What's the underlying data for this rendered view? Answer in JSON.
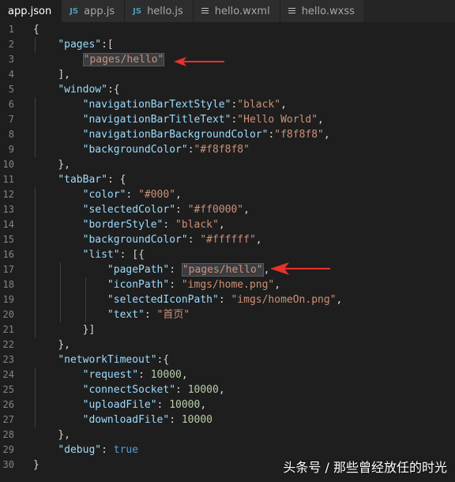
{
  "tabs": [
    {
      "label": "app.json",
      "icon": "none",
      "active": true
    },
    {
      "label": "app.js",
      "icon": "js-icon",
      "active": false
    },
    {
      "label": "hello.js",
      "icon": "js-icon",
      "active": false
    },
    {
      "label": "hello.wxml",
      "icon": "lines-icon",
      "active": false
    },
    {
      "label": "hello.wxss",
      "icon": "lines-icon",
      "active": false
    }
  ],
  "js_badge": "JS",
  "code_lines": [
    {
      "n": "1",
      "tokens": [
        {
          "t": "{",
          "c": "p"
        }
      ]
    },
    {
      "n": "2",
      "tokens": [
        {
          "t": "    "
        },
        {
          "t": "\"pages\"",
          "c": "key"
        },
        {
          "t": ":[",
          "c": "p"
        }
      ]
    },
    {
      "n": "3",
      "tokens": [
        {
          "t": "        "
        },
        {
          "t": "\"pages/hello\"",
          "c": "str",
          "hl": true
        }
      ]
    },
    {
      "n": "4",
      "tokens": [
        {
          "t": "    "
        },
        {
          "t": "],",
          "c": "p"
        }
      ]
    },
    {
      "n": "5",
      "tokens": [
        {
          "t": "    "
        },
        {
          "t": "\"window\"",
          "c": "key"
        },
        {
          "t": ":{",
          "c": "p"
        }
      ]
    },
    {
      "n": "6",
      "tokens": [
        {
          "t": "        "
        },
        {
          "t": "\"navigationBarTextStyle\"",
          "c": "key"
        },
        {
          "t": ":",
          "c": "p"
        },
        {
          "t": "\"black\"",
          "c": "str"
        },
        {
          "t": ",",
          "c": "p"
        }
      ]
    },
    {
      "n": "7",
      "tokens": [
        {
          "t": "        "
        },
        {
          "t": "\"navigationBarTitleText\"",
          "c": "key"
        },
        {
          "t": ":",
          "c": "p"
        },
        {
          "t": "\"Hello World\"",
          "c": "str"
        },
        {
          "t": ",",
          "c": "p"
        }
      ]
    },
    {
      "n": "8",
      "tokens": [
        {
          "t": "        "
        },
        {
          "t": "\"navigationBarBackgroundColor\"",
          "c": "key"
        },
        {
          "t": ":",
          "c": "p"
        },
        {
          "t": "\"f8f8f8\"",
          "c": "str"
        },
        {
          "t": ",",
          "c": "p"
        }
      ]
    },
    {
      "n": "9",
      "tokens": [
        {
          "t": "        "
        },
        {
          "t": "\"backgroundColor\"",
          "c": "key"
        },
        {
          "t": ":",
          "c": "p"
        },
        {
          "t": "\"#f8f8f8\"",
          "c": "str"
        }
      ]
    },
    {
      "n": "10",
      "tokens": [
        {
          "t": "    "
        },
        {
          "t": "},",
          "c": "p"
        }
      ]
    },
    {
      "n": "11",
      "tokens": [
        {
          "t": "    "
        },
        {
          "t": "\"tabBar\"",
          "c": "key"
        },
        {
          "t": ": {",
          "c": "p"
        }
      ]
    },
    {
      "n": "12",
      "tokens": [
        {
          "t": "        "
        },
        {
          "t": "\"color\"",
          "c": "key"
        },
        {
          "t": ": ",
          "c": "p"
        },
        {
          "t": "\"#000\"",
          "c": "str"
        },
        {
          "t": ",",
          "c": "p"
        }
      ]
    },
    {
      "n": "13",
      "tokens": [
        {
          "t": "        "
        },
        {
          "t": "\"selectedColor\"",
          "c": "key"
        },
        {
          "t": ": ",
          "c": "p"
        },
        {
          "t": "\"#ff0000\"",
          "c": "str"
        },
        {
          "t": ",",
          "c": "p"
        }
      ]
    },
    {
      "n": "14",
      "tokens": [
        {
          "t": "        "
        },
        {
          "t": "\"borderStyle\"",
          "c": "key"
        },
        {
          "t": ": ",
          "c": "p"
        },
        {
          "t": "\"black\"",
          "c": "str"
        },
        {
          "t": ",",
          "c": "p"
        }
      ]
    },
    {
      "n": "15",
      "tokens": [
        {
          "t": "        "
        },
        {
          "t": "\"backgroundColor\"",
          "c": "key"
        },
        {
          "t": ": ",
          "c": "p"
        },
        {
          "t": "\"#ffffff\"",
          "c": "str"
        },
        {
          "t": ",",
          "c": "p"
        }
      ]
    },
    {
      "n": "16",
      "tokens": [
        {
          "t": "        "
        },
        {
          "t": "\"list\"",
          "c": "key"
        },
        {
          "t": ": [{",
          "c": "p"
        }
      ]
    },
    {
      "n": "17",
      "tokens": [
        {
          "t": "            "
        },
        {
          "t": "\"pagePath\"",
          "c": "key"
        },
        {
          "t": ": ",
          "c": "p"
        },
        {
          "t": "\"pages/hello\"",
          "c": "str",
          "hl": true
        },
        {
          "t": ",",
          "c": "p"
        }
      ]
    },
    {
      "n": "18",
      "tokens": [
        {
          "t": "            "
        },
        {
          "t": "\"iconPath\"",
          "c": "key"
        },
        {
          "t": ": ",
          "c": "p"
        },
        {
          "t": "\"imgs/home.png\"",
          "c": "str"
        },
        {
          "t": ",",
          "c": "p"
        }
      ]
    },
    {
      "n": "19",
      "tokens": [
        {
          "t": "            "
        },
        {
          "t": "\"selectedIconPath\"",
          "c": "key"
        },
        {
          "t": ": ",
          "c": "p"
        },
        {
          "t": "\"imgs/homeOn.png\"",
          "c": "str"
        },
        {
          "t": ",",
          "c": "p"
        }
      ]
    },
    {
      "n": "20",
      "tokens": [
        {
          "t": "            "
        },
        {
          "t": "\"text\"",
          "c": "key"
        },
        {
          "t": ": ",
          "c": "p"
        },
        {
          "t": "\"首页\"",
          "c": "str"
        }
      ]
    },
    {
      "n": "21",
      "tokens": [
        {
          "t": "        "
        },
        {
          "t": "}]",
          "c": "p"
        }
      ]
    },
    {
      "n": "22",
      "tokens": [
        {
          "t": "    "
        },
        {
          "t": "},",
          "c": "p"
        }
      ]
    },
    {
      "n": "23",
      "tokens": [
        {
          "t": "    "
        },
        {
          "t": "\"networkTimeout\"",
          "c": "key"
        },
        {
          "t": ":{",
          "c": "p"
        }
      ]
    },
    {
      "n": "24",
      "tokens": [
        {
          "t": "        "
        },
        {
          "t": "\"request\"",
          "c": "key"
        },
        {
          "t": ": ",
          "c": "p"
        },
        {
          "t": "10000",
          "c": "num"
        },
        {
          "t": ",",
          "c": "p"
        }
      ]
    },
    {
      "n": "25",
      "tokens": [
        {
          "t": "        "
        },
        {
          "t": "\"connectSocket\"",
          "c": "key"
        },
        {
          "t": ": ",
          "c": "p"
        },
        {
          "t": "10000",
          "c": "num"
        },
        {
          "t": ",",
          "c": "p"
        }
      ]
    },
    {
      "n": "26",
      "tokens": [
        {
          "t": "        "
        },
        {
          "t": "\"uploadFile\"",
          "c": "key"
        },
        {
          "t": ": ",
          "c": "p"
        },
        {
          "t": "10000",
          "c": "num"
        },
        {
          "t": ",",
          "c": "p"
        }
      ]
    },
    {
      "n": "27",
      "tokens": [
        {
          "t": "        "
        },
        {
          "t": "\"downloadFile\"",
          "c": "key"
        },
        {
          "t": ": ",
          "c": "p"
        },
        {
          "t": "10000",
          "c": "num"
        }
      ]
    },
    {
      "n": "28",
      "tokens": [
        {
          "t": "    "
        },
        {
          "t": "},",
          "c": "p"
        }
      ]
    },
    {
      "n": "29",
      "tokens": [
        {
          "t": "    "
        },
        {
          "t": "\"debug\"",
          "c": "key"
        },
        {
          "t": ": ",
          "c": "p"
        },
        {
          "t": "true",
          "c": "kw"
        }
      ]
    },
    {
      "n": "30",
      "tokens": [
        {
          "t": "}",
          "c": "p"
        }
      ]
    }
  ],
  "watermark": "头条号 / 那些曾经放任的时光",
  "arrow_color": "#e8312a"
}
